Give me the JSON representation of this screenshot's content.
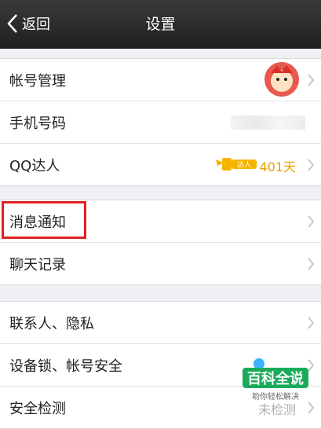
{
  "header": {
    "back_label": "返回",
    "title": "设置"
  },
  "groups": [
    {
      "items": [
        {
          "label": "帐号管理"
        },
        {
          "label": "手机号码"
        },
        {
          "label": "QQ达人",
          "value": "401天",
          "badge_text": "达人"
        }
      ]
    },
    {
      "items": [
        {
          "label": "消息通知"
        },
        {
          "label": "聊天记录"
        }
      ]
    },
    {
      "items": [
        {
          "label": "联系人、隐私"
        },
        {
          "label": "设备锁、帐号安全"
        },
        {
          "label": "安全检测",
          "value": "未检测"
        }
      ]
    }
  ],
  "watermark": {
    "title": "百科全说",
    "subtitle": "助你轻松解决"
  },
  "colors": {
    "highlight": "#e02020",
    "gold": "#e8a000",
    "header_bg": "#1f1f1f"
  }
}
